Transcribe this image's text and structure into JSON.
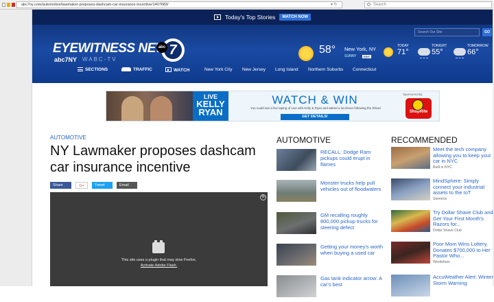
{
  "browser": {
    "url": "abc7ny.com/automotive/lawmaker-proposes-dashcam-car-insurance-incentive/1407683/",
    "controls": "▾  ↻",
    "search_placeholder": "Search"
  },
  "header": {
    "top_stories_label": "Today's Top Stories",
    "watch_now": "WATCH NOW",
    "logo_title": "EYEWITNESS NEWS",
    "logo_abc": "abc",
    "logo_number": "7",
    "logo_sub": "abc7NY",
    "logo_callsign": "WABC-TV",
    "search_placeholder": "Search Our Site",
    "go": "GO"
  },
  "weather": {
    "current_temp": "58°",
    "city": "New York, NY",
    "condition": "SUNNY",
    "badge": "EDIT",
    "forecast": [
      {
        "label": "TODAY",
        "temp": "71°",
        "icon": "sun-cloud-icon"
      },
      {
        "label": "TONIGHT",
        "temp": "55°",
        "icon": "rain-cloud-icon"
      },
      {
        "label": "TOMORROW",
        "temp": "66°",
        "icon": "sun-rain-icon"
      }
    ]
  },
  "nav": {
    "sections": "SECTIONS",
    "traffic": "TRAFFIC",
    "watch": "WATCH",
    "links": [
      "New York City",
      "New Jersey",
      "Long Island",
      "Northern Suburbs",
      "Connecticut"
    ]
  },
  "ad": {
    "live_line1": "LIVE",
    "live_line2": "KELLY",
    "live_line3": "RYAN",
    "watch_win": "WATCH & WIN",
    "copy": "You could see a live taping of Live with Kelly & Ryan and attend a luncheon following the Show!",
    "cta": "GET DETAILS!",
    "sponsor_label": "Sponsored By:",
    "sponsor_name": "ShopRite"
  },
  "article": {
    "kicker": "AUTOMOTIVE",
    "headline": "NY Lawmaker proposes dashcam car insurance incentive",
    "share": {
      "facebook": "Share",
      "google": "G+",
      "twitter": "Tweet",
      "email": "Email"
    },
    "flash_message": "This site uses a plugin that may slow Firefox.",
    "flash_link": "Activate Adobe Flash.",
    "close_glyph": "⊗"
  },
  "automotive": {
    "title": "AUTOMOTIVE",
    "items": [
      {
        "text": "RECALL: Dodge Ram pickups could erupt in flames"
      },
      {
        "text": "Monster trucks help pull vehicles out of floodwaters"
      },
      {
        "text": "GM recalling roughly 800,000 pickup trucks for steering defect"
      },
      {
        "text": "Getting your money's worth when buying a used car"
      },
      {
        "text": "Gas tank indicator arrow: A car's best"
      }
    ]
  },
  "recommended": {
    "title": "RECOMMENDED",
    "items": [
      {
        "text": "Meet the tech company allowing you to keep your car in NYC",
        "source": "Built in NYC"
      },
      {
        "text": "MindSphere: Simply connect your industrial assets to the IoT",
        "source": "Siemens"
      },
      {
        "text": "Try Dollar Shave Club and Get Your First Month's Razors for...",
        "source": "Dollar Shave Club"
      },
      {
        "text": "Poor Mom Wins Lottery, Donates $700,000 to Her Pastor Who...",
        "source": "Wordsfoon"
      },
      {
        "text": "AccuWeather Alert: Winter Storm Warning",
        "source": ""
      }
    ]
  },
  "colors": {
    "header_blue": "#1a4aa3",
    "link_blue": "#2764c5",
    "ad_blue": "#0a6ec7"
  }
}
